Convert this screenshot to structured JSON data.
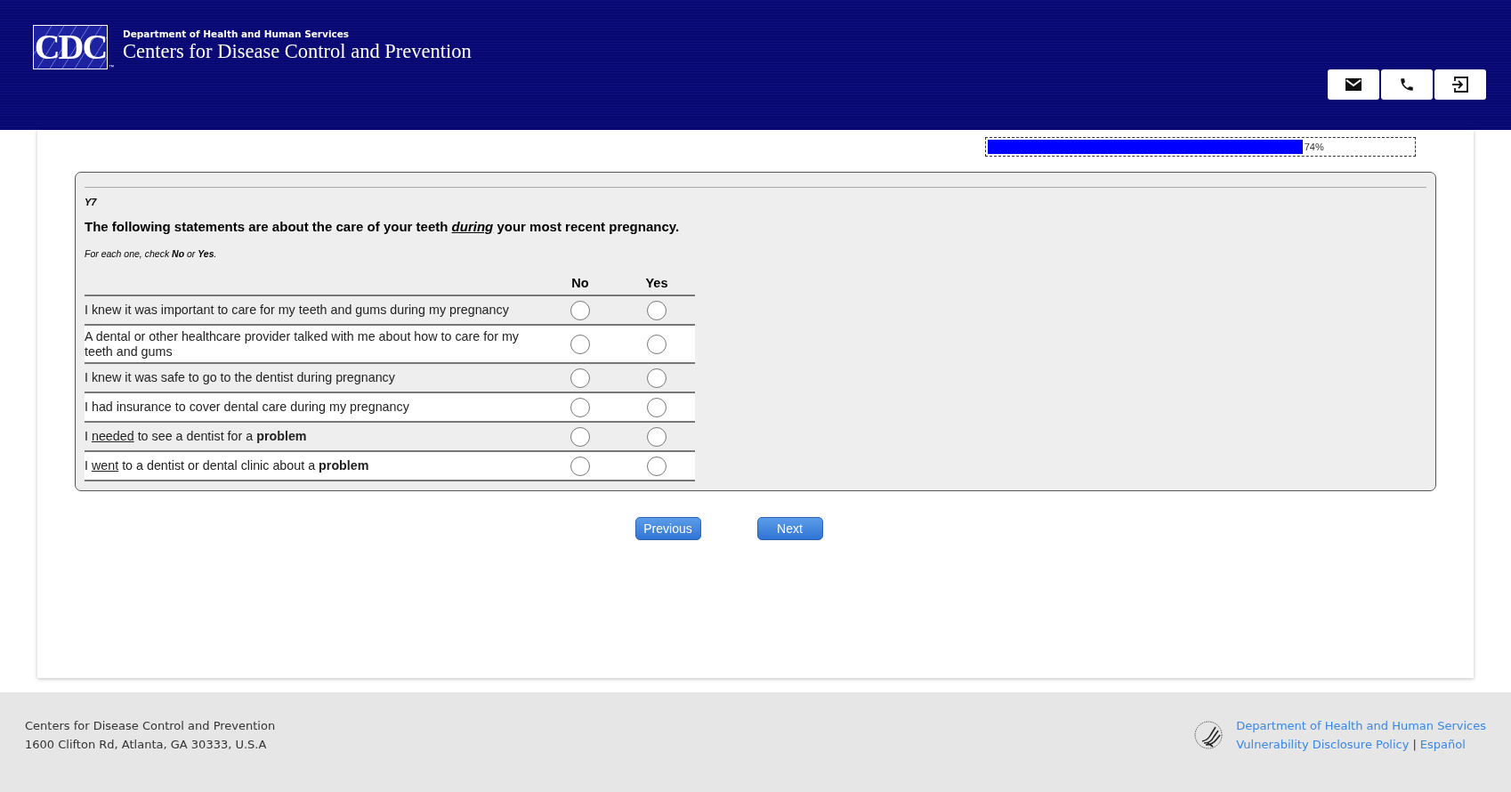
{
  "header": {
    "logo": {
      "text": "CDC",
      "trademark": "™"
    },
    "department": "Department of Health and Human Services",
    "agency": "Centers for Disease Control and Prevention",
    "actions": [
      {
        "kind": "email"
      },
      {
        "kind": "phone"
      },
      {
        "kind": "exit"
      }
    ]
  },
  "progress": {
    "level": 0.74,
    "reading": "74%"
  },
  "question": {
    "code": "Y7",
    "title": "The following statements are about the care of your teeth *during* your most recent pregnancy.",
    "instruction": "For each one, check **No** or **Yes**.",
    "columns": [
      "No",
      "Yes"
    ],
    "rows": [
      {
        "text": "I knew it was important to care for my teeth and gums during my pregnancy",
        "choices": [
          {
            "selected": false
          },
          {
            "selected": false
          }
        ]
      },
      {
        "text": "A dental or other healthcare provider talked with me about how to care for my teeth and gums",
        "choices": [
          {
            "selected": false
          },
          {
            "selected": false
          }
        ]
      },
      {
        "text": "I knew it was safe to go to the dentist during pregnancy",
        "choices": [
          {
            "selected": false
          },
          {
            "selected": false
          }
        ]
      },
      {
        "text": "I had insurance to cover dental care during my pregnancy",
        "choices": [
          {
            "selected": false
          },
          {
            "selected": false
          }
        ]
      },
      {
        "text": "I *needed* to see a dentist for a **problem**",
        "choices": [
          {
            "selected": false
          },
          {
            "selected": false
          }
        ]
      },
      {
        "text": "I *went* to a dentist or dental clinic about a **problem**",
        "choices": [
          {
            "selected": false
          },
          {
            "selected": false
          }
        ]
      }
    ]
  },
  "navigation": [
    "Previous",
    "Next"
  ],
  "footer": {
    "address": [
      "Centers for Disease Control and Prevention",
      "1600 Clifton Rd, Atlanta, GA 30333, U.S.A"
    ],
    "links": [
      "Department of Health and Human Services",
      "Vulnerability Disclosure Policy",
      "Español"
    ],
    "separator": "|"
  }
}
